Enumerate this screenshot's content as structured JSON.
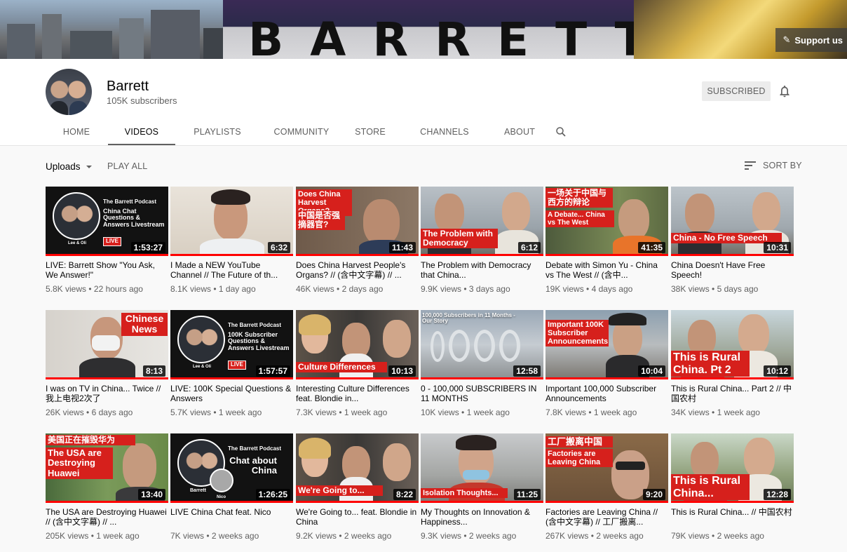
{
  "banner": {
    "word": "BARRETT",
    "support_label": "Support us"
  },
  "channel": {
    "name": "Barrett",
    "subscribers": "105K subscribers",
    "subscribed_label": "SUBSCRIBED"
  },
  "tabs": [
    "HOME",
    "VIDEOS",
    "PLAYLISTS",
    "COMMUNITY",
    "STORE",
    "CHANNELS",
    "ABOUT"
  ],
  "active_tab": "VIDEOS",
  "subhead": {
    "uploads_label": "Uploads",
    "play_all_label": "PLAY ALL",
    "sort_label": "SORT BY"
  },
  "videos": [
    {
      "title": "LIVE: Barrett Show \"You Ask, We Answer!\"",
      "views": "5.8K views",
      "age": "22 hours ago",
      "duration": "1:53:27",
      "thumb_text": "The Barrett Podcast",
      "thumb_sub": "China Chat Questions & Answers Livestream",
      "thumb_badge": "LIVE",
      "thumb_small": "Lee & Oli"
    },
    {
      "title": "I Made a NEW YouTube Channel // The Future of th...",
      "views": "8.1K views",
      "age": "1 day ago",
      "duration": "6:32"
    },
    {
      "title": "Does China Harvest People's Organs? // (含中文字幕) // ...",
      "views": "46K views",
      "age": "2 days ago",
      "duration": "11:43",
      "thumb_text": "Does China Harvest Organs?",
      "thumb_sub": "中国是否强摘器官?"
    },
    {
      "title": "The Problem with Democracy that China...",
      "views": "9.9K views",
      "age": "3 days ago",
      "duration": "6:12",
      "thumb_text": "The Problem with Democracy"
    },
    {
      "title": "Debate with Simon Yu - China vs The West // (含中...",
      "views": "19K views",
      "age": "4 days ago",
      "duration": "41:35",
      "thumb_text": "一场关于中国与西方的辩论",
      "thumb_sub": "A Debate... China vs The West"
    },
    {
      "title": "China Doesn't Have Free Speech!",
      "views": "38K views",
      "age": "5 days ago",
      "duration": "10:31",
      "thumb_text": "China - No Free Speech"
    },
    {
      "title": "I was on TV in China... Twice // 我上电视2次了",
      "views": "26K views",
      "age": "6 days ago",
      "duration": "8:13",
      "thumb_text": "Chinese News"
    },
    {
      "title": "LIVE: 100K Special Questions & Answers",
      "views": "5.7K views",
      "age": "1 week ago",
      "duration": "1:57:57",
      "thumb_text": "The Barrett Podcast",
      "thumb_sub": "100K Subscriber Questions & Answers Livestream",
      "thumb_badge": "LIVE",
      "thumb_small": "Lee & Oli"
    },
    {
      "title": "Interesting Culture Differences feat. Blondie in...",
      "views": "7.3K views",
      "age": "1 week ago",
      "duration": "10:13",
      "thumb_text": "Culture Differences"
    },
    {
      "title": "0 - 100,000 SUBSCRIBERS IN 11 MONTHS",
      "views": "10K views",
      "age": "1 week ago",
      "duration": "12:58",
      "thumb_text": "100,000 Subscribers in 11 Months - Our Story"
    },
    {
      "title": "Important 100,000 Subscriber Announcements",
      "views": "7.8K views",
      "age": "1 week ago",
      "duration": "10:04",
      "thumb_text": "Important 100K Subscriber Announcements"
    },
    {
      "title": "This is Rural China... Part 2 // 中国农村",
      "views": "34K views",
      "age": "1 week ago",
      "duration": "10:12",
      "thumb_text": "This is Rural China. Pt 2"
    },
    {
      "title": "The USA are Destroying Huawei // (含中文字幕) // ...",
      "views": "205K views",
      "age": "1 week ago",
      "duration": "13:40",
      "thumb_text": "美国正在摧毁华为",
      "thumb_sub": "The USA are Destroying Huawei"
    },
    {
      "title": "LIVE China Chat feat. Nico",
      "views": "7K views",
      "age": "2 weeks ago",
      "duration": "1:26:25",
      "thumb_text": "The Barrett Podcast",
      "thumb_sub": "Chat about China",
      "thumb_small": "Barrett",
      "thumb_small2": "Nico"
    },
    {
      "title": "We're Going to... feat. Blondie in China",
      "views": "9.2K views",
      "age": "2 weeks ago",
      "duration": "8:22",
      "thumb_text": "We're Going to..."
    },
    {
      "title": "My Thoughts on Innovation & Happiness...",
      "views": "9.3K views",
      "age": "2 weeks ago",
      "duration": "11:25",
      "thumb_text": "Isolation Thoughts..."
    },
    {
      "title": "Factories are Leaving China // (含中文字幕) // 工厂搬离...",
      "views": "267K views",
      "age": "2 weeks ago",
      "duration": "9:20",
      "thumb_text": "工厂搬离中国",
      "thumb_sub": "Factories are Leaving China"
    },
    {
      "title": "This is Rural China... // 中国农村",
      "views": "79K views",
      "age": "2 weeks ago",
      "duration": "12:28",
      "thumb_text": "This is Rural China..."
    }
  ],
  "colors": {
    "accent": "#ff0000",
    "caption_red": "#d6201c",
    "text_primary": "#030303",
    "text_secondary": "#606060"
  }
}
